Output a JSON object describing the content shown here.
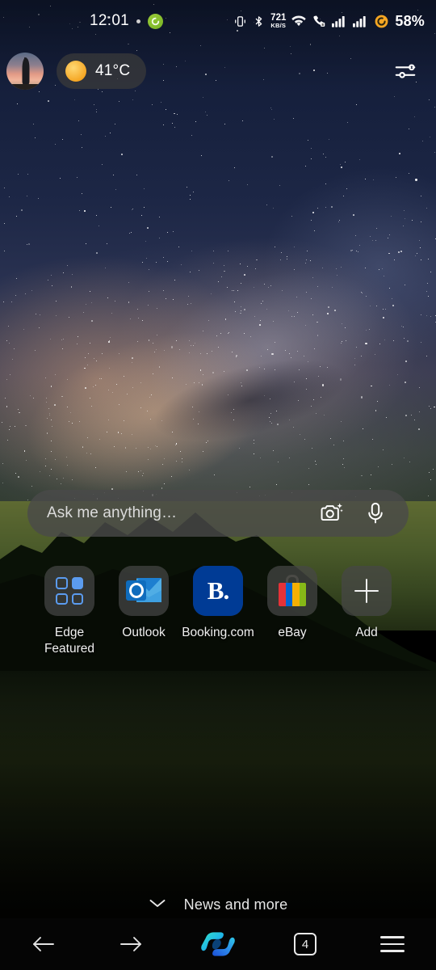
{
  "status_bar": {
    "time": "12:01",
    "app_badge_icon": "green-app-badge-icon",
    "icons": [
      "vibrate-icon",
      "bluetooth-icon",
      "wifi-icon",
      "missed-call-icon",
      "signal-sim1-icon",
      "signal-sim2-icon"
    ],
    "network_speed_value": "721",
    "network_speed_unit": "KB/S",
    "battery_percent": "58%",
    "battery_color": "#f5a623"
  },
  "top_bar": {
    "avatar_label": "profile-avatar",
    "weather": {
      "icon": "sun-icon",
      "temperature": "41°C"
    },
    "settings_icon": "sliders-settings-icon"
  },
  "search": {
    "placeholder": "Ask me anything…",
    "camera_icon": "camera-lens-search-icon",
    "mic_icon": "microphone-icon"
  },
  "shortcuts": [
    {
      "label": "Edge\nFeatured",
      "label_line1": "Edge",
      "label_line2": "Featured",
      "icon": "edge-featured-grid-icon",
      "accent": "#5b9bef"
    },
    {
      "label": "Outlook",
      "label_line1": "Outlook",
      "label_line2": "",
      "icon": "outlook-icon",
      "accent": "#0f6cbd"
    },
    {
      "label": "Booking.com",
      "label_line1": "Booking.com",
      "label_line2": "",
      "icon": "booking-com-icon",
      "accent": "#003b95",
      "glyph": "B."
    },
    {
      "label": "eBay",
      "label_line1": "eBay",
      "label_line2": "",
      "icon": "ebay-shopping-bag-icon",
      "accent": "#e53238"
    },
    {
      "label": "Add",
      "label_line1": "Add",
      "label_line2": "",
      "icon": "plus-add-icon",
      "accent": "#f2f2f2"
    }
  ],
  "news_section": {
    "label": "News and more",
    "chevron_icon": "chevron-down-icon"
  },
  "bottom_nav": {
    "back_icon": "back-arrow-icon",
    "forward_icon": "forward-arrow-icon",
    "copilot_icon": "copilot-icon",
    "tab_count": "4",
    "menu_icon": "hamburger-menu-icon"
  },
  "wallpaper": {
    "description": "milky-way-night-sky-over-hills"
  }
}
